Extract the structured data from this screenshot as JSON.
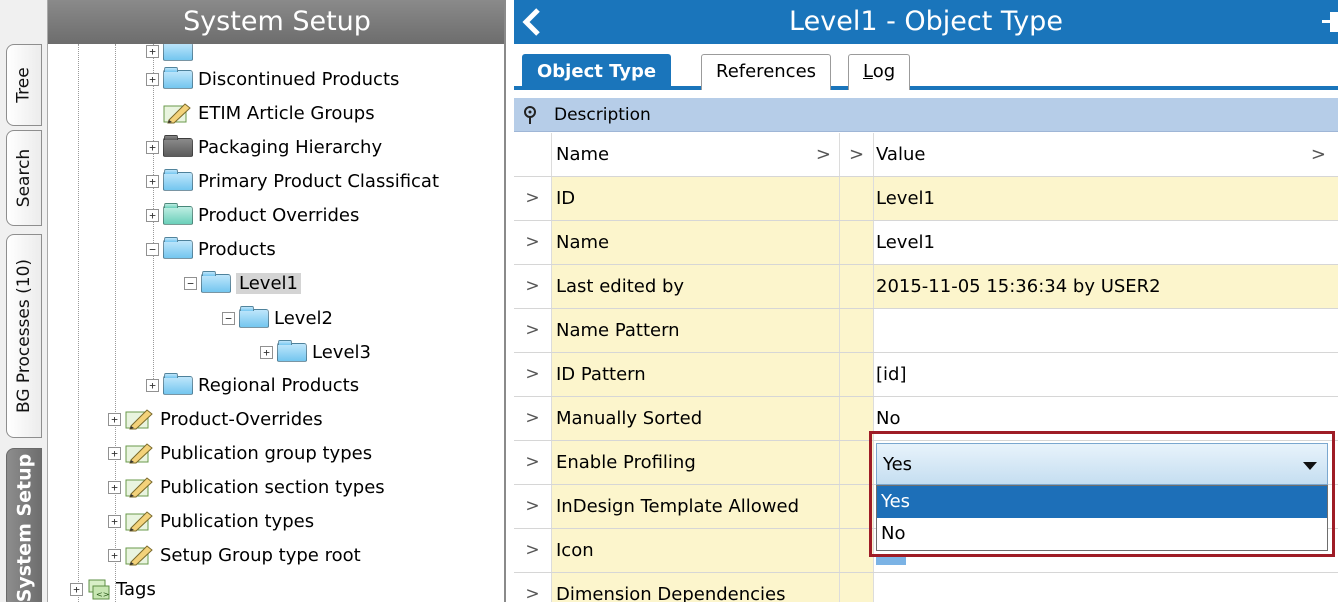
{
  "side_tabs": {
    "tree": "Tree",
    "search": "Search",
    "bg_processes": "BG Processes (10)",
    "system_setup": "System Setup"
  },
  "tree": {
    "title": "System Setup",
    "items": [
      {
        "label": "Discontinued Products",
        "icon": "folder-icon",
        "color": "#74c6ef"
      },
      {
        "label": "ETIM Article Groups",
        "icon": "setup-pencil-icon"
      },
      {
        "label": "Packaging Hierarchy",
        "icon": "folder-icon",
        "color": "#5c5c5c"
      },
      {
        "label": "Primary Product Classificat",
        "icon": "folder-icon",
        "color": "#74c6ef"
      },
      {
        "label": "Product Overrides",
        "icon": "folder-icon",
        "color": "#6bcfb9"
      },
      {
        "label": "Products",
        "icon": "folder-icon",
        "color": "#74c6ef"
      },
      {
        "label": "Level1",
        "icon": "folder-icon",
        "color": "#74c6ef",
        "selected": true
      },
      {
        "label": "Level2",
        "icon": "folder-icon",
        "color": "#74c6ef"
      },
      {
        "label": "Level3",
        "icon": "folder-icon",
        "color": "#74c6ef"
      },
      {
        "label": "Regional Products",
        "icon": "folder-icon",
        "color": "#74c6ef"
      },
      {
        "label": "Product-Overrides",
        "icon": "setup-pencil-icon"
      },
      {
        "label": "Publication group types",
        "icon": "setup-pencil-icon"
      },
      {
        "label": "Publication section types",
        "icon": "setup-pencil-icon"
      },
      {
        "label": "Publication types",
        "icon": "setup-pencil-icon"
      },
      {
        "label": "Setup Group type root",
        "icon": "setup-pencil-icon"
      },
      {
        "label": "Tags",
        "icon": "tags-icon"
      }
    ]
  },
  "detail": {
    "title": "Level1 - Object Type",
    "tabs": {
      "object_type": "Object Type",
      "references": "References",
      "log_first": "L",
      "log_rest": "og"
    },
    "group": "Description",
    "columns": {
      "name": "Name",
      "value": "Value"
    },
    "rows": [
      {
        "name": "ID",
        "value": "Level1"
      },
      {
        "name": "Name",
        "value": "Level1"
      },
      {
        "name": "Last edited by",
        "value": "2015-11-05 15:36:34 by USER2"
      },
      {
        "name": "Name Pattern",
        "value": ""
      },
      {
        "name": "ID Pattern",
        "value": "[id]"
      },
      {
        "name": "Manually Sorted",
        "value": "No"
      },
      {
        "name": "Enable Profiling",
        "value": ""
      },
      {
        "name": "InDesign Template Allowed",
        "value": ""
      },
      {
        "name": "Icon",
        "value": ""
      },
      {
        "name": "Dimension Dependencies",
        "value": ""
      }
    ],
    "dropdown": {
      "selected": "Yes",
      "options": [
        "Yes",
        "No"
      ],
      "highlighted_option": "Yes"
    }
  },
  "colors": {
    "accent": "#1a75bb",
    "tree_header": "#7a7a7a",
    "name_cell": "#fcf5cc",
    "group_row": "#b6cde8",
    "highlight_box": "#9e1c26"
  }
}
